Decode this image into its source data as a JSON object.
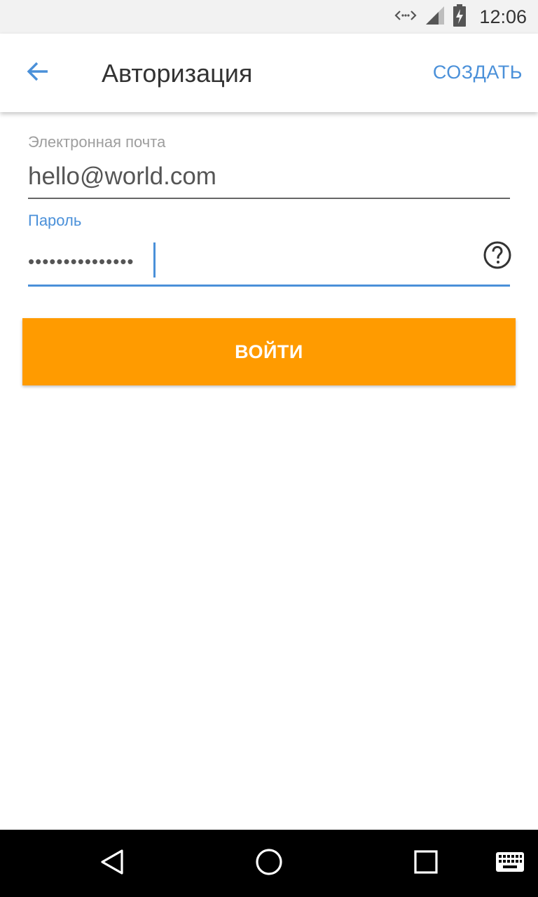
{
  "status_bar": {
    "time": "12:06",
    "icons": [
      "data-transfer-icon",
      "signal-icon",
      "battery-charging-icon"
    ]
  },
  "app_bar": {
    "back_icon": "arrow-back-icon",
    "title": "Авторизация",
    "action_label": "СОЗДАТЬ"
  },
  "form": {
    "email_label": "Электронная почта",
    "email_value": "hello@world.com",
    "password_label": "Пароль",
    "password_masked": "•••••••••••••••",
    "help_icon": "help-circle-icon"
  },
  "login_button": {
    "label": "ВОЙТИ"
  },
  "nav_bar": {
    "buttons": [
      "back-triangle-icon",
      "home-circle-icon",
      "recents-square-icon",
      "keyboard-icon"
    ]
  },
  "colors": {
    "accent": "#4a90d9",
    "button": "#ff9b00",
    "status_bar": "#f2f2f2",
    "nav_bar": "#000000"
  }
}
